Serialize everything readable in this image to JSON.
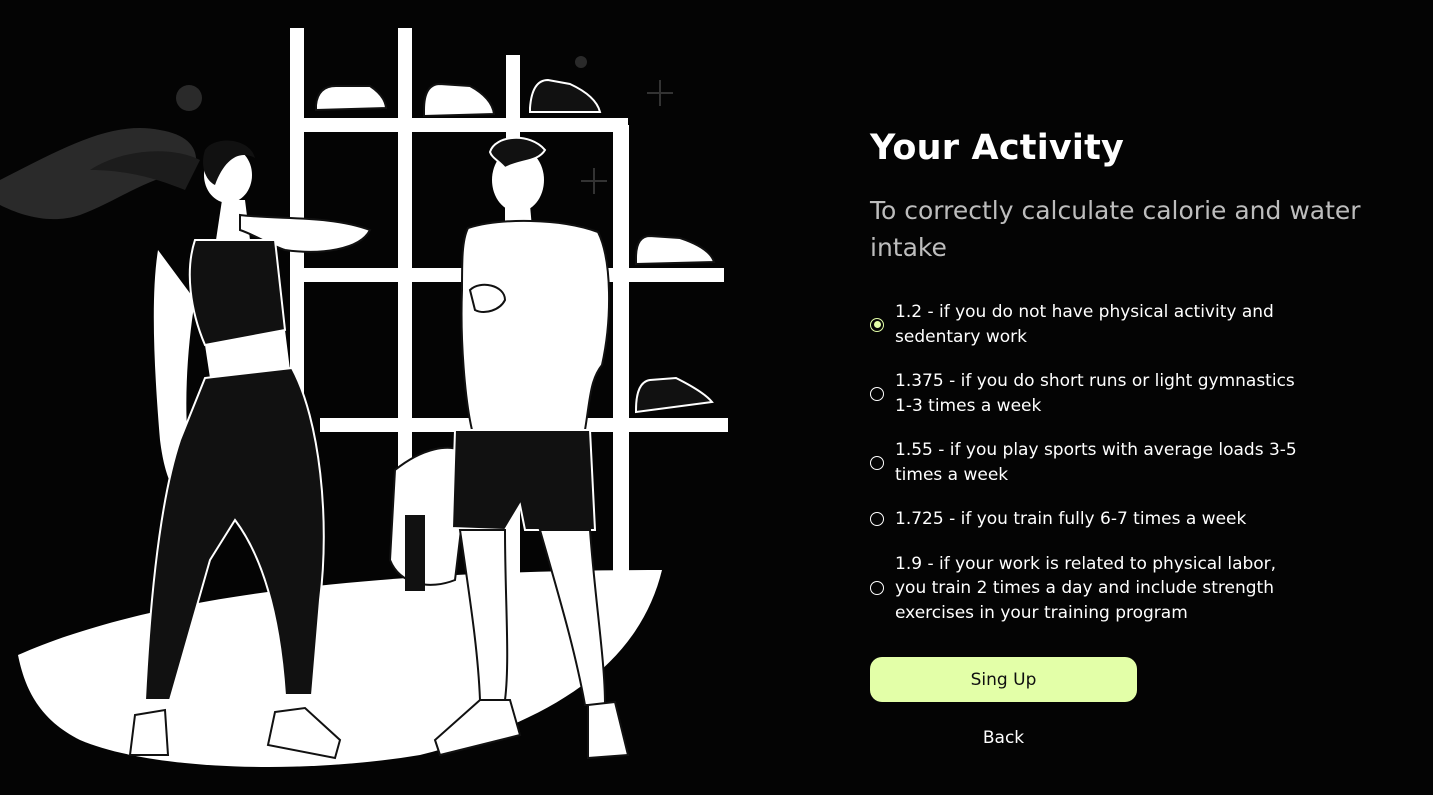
{
  "title": "Your Activity",
  "subtitle": "To correctly calculate calorie and water intake",
  "options": [
    {
      "label": "1.2 - if you do not have physical activity and sedentary work",
      "selected": true
    },
    {
      "label": "1.375 - if you do short runs or light gymnastics 1-3 times a week",
      "selected": false
    },
    {
      "label": "1.55 - if you play sports with average loads 3-5 times a week",
      "selected": false
    },
    {
      "label": "1.725 - if you train fully 6-7 times a week",
      "selected": false
    },
    {
      "label": "1.9 - if your work is related to physical labor, you train 2 times a day and include strength exercises in your training program",
      "selected": false
    }
  ],
  "buttons": {
    "signup": "Sing Up",
    "back": "Back"
  },
  "colors": {
    "background": "#040404",
    "accent": "#e3ffa8",
    "subtitle": "#bdbdbd"
  }
}
